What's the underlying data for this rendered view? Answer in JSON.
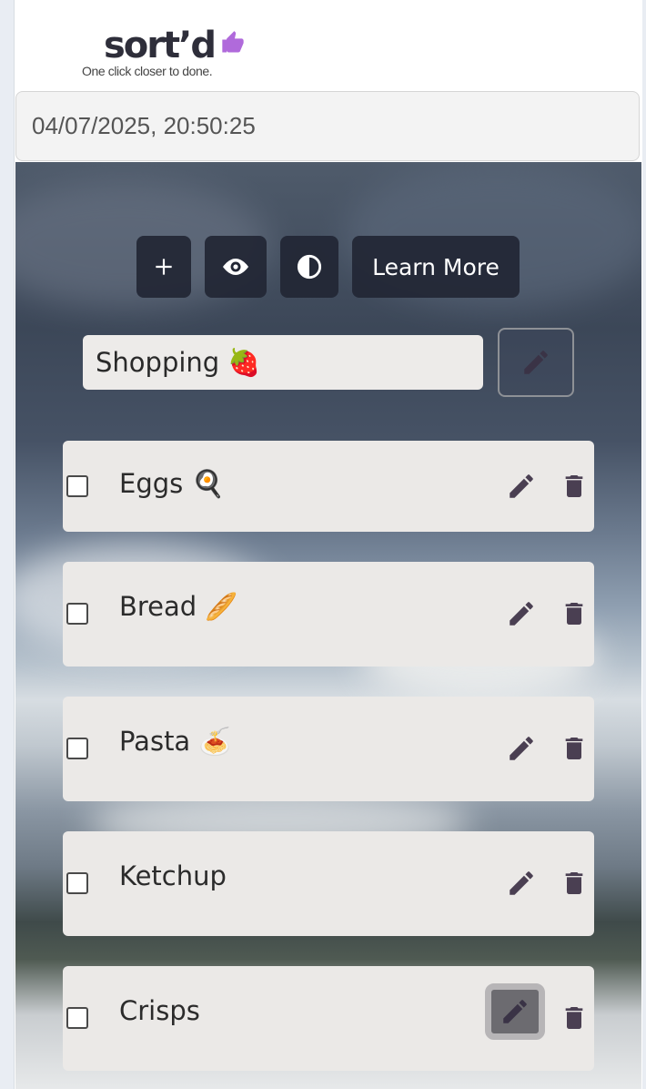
{
  "app": {
    "logo": {
      "word": "sort’d",
      "tagline": "One click closer to done."
    },
    "datetime": "04/07/2025, 20:50:25"
  },
  "toolbar": {
    "add_icon": "plus-icon",
    "view_icon": "eye-icon",
    "theme_icon": "contrast-icon",
    "learn_more_label": "Learn More"
  },
  "list": {
    "name": "Shopping 🍓",
    "edit_icon": "pencil-icon"
  },
  "items": [
    {
      "label": "Eggs 🍳",
      "checked": false
    },
    {
      "label": "Bread 🥖",
      "checked": false
    },
    {
      "label": "Pasta 🍝",
      "checked": false
    },
    {
      "label": "Ketchup",
      "checked": false
    },
    {
      "label": "Crisps",
      "checked": false
    }
  ],
  "colors": {
    "brand": "#2e2e3a",
    "thumb_accent": "#b06adb",
    "button_bg": "#222634",
    "item_bg": "#ebe9e7",
    "icon": "#4a3f52"
  }
}
